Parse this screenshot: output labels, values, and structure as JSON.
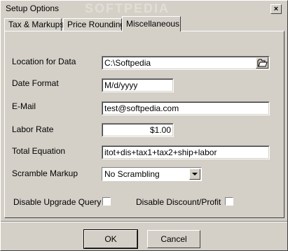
{
  "window": {
    "title": "Setup Options",
    "watermark": "SOFTPEDIA",
    "close_glyph": "×"
  },
  "tabs": [
    {
      "label": "Tax & Markups"
    },
    {
      "label": "Price Rounding"
    },
    {
      "label": "Miscellaneous"
    }
  ],
  "form": {
    "location_label": "Location for Data",
    "location_value": "C:\\Softpedia",
    "date_format_label": "Date Format",
    "date_format_value": "M/d/yyyy",
    "email_label": "E-Mail",
    "email_value": "test@softpedia.com",
    "labor_rate_label": "Labor Rate",
    "labor_rate_value": "$1.00",
    "total_equation_label": "Total Equation",
    "total_equation_value": "itot+dis+tax1+tax2+ship+labor",
    "scramble_label": "Scramble Markup",
    "scramble_value": "No Scrambling",
    "disable_upgrade_label": "Disable Upgrade Query",
    "disable_upgrade_checked": false,
    "disable_discount_label": "Disable Discount/Profit",
    "disable_discount_checked": false
  },
  "buttons": {
    "ok": "OK",
    "cancel": "Cancel"
  }
}
